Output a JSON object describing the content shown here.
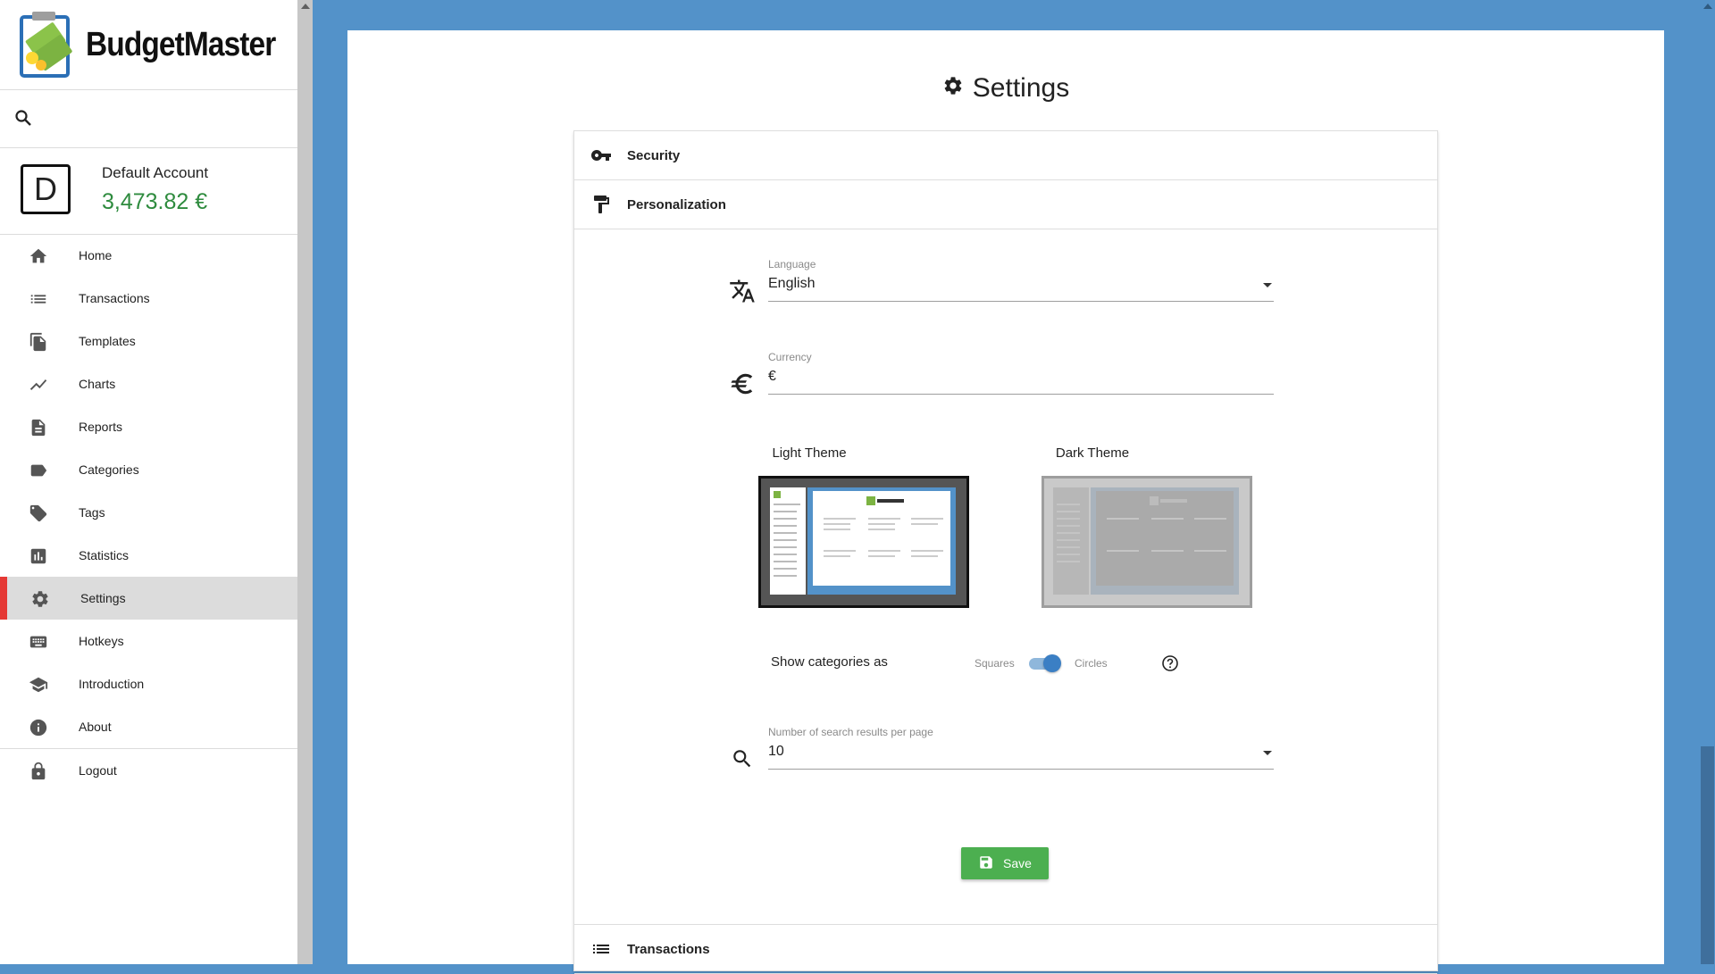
{
  "app": {
    "name": "BudgetMaster"
  },
  "account": {
    "avatar_letter": "D",
    "name": "Default Account",
    "balance": "3,473.82 €"
  },
  "nav": {
    "items": [
      {
        "label": "Home",
        "icon": "home-icon"
      },
      {
        "label": "Transactions",
        "icon": "list-icon"
      },
      {
        "label": "Templates",
        "icon": "file-copy-icon"
      },
      {
        "label": "Charts",
        "icon": "line-chart-icon"
      },
      {
        "label": "Reports",
        "icon": "description-icon"
      },
      {
        "label": "Categories",
        "icon": "label-icon"
      },
      {
        "label": "Tags",
        "icon": "tag-icon"
      },
      {
        "label": "Statistics",
        "icon": "bar-chart-icon"
      },
      {
        "label": "Settings",
        "icon": "gear-icon",
        "active": true
      },
      {
        "label": "Hotkeys",
        "icon": "keyboard-icon"
      },
      {
        "label": "Introduction",
        "icon": "school-icon"
      },
      {
        "label": "About",
        "icon": "info-icon"
      },
      {
        "label": "Logout",
        "icon": "lock-icon"
      }
    ]
  },
  "page": {
    "title": "Settings"
  },
  "sections": {
    "security": "Security",
    "personalization": "Personalization",
    "transactions": "Transactions"
  },
  "personalization": {
    "language": {
      "label": "Language",
      "value": "English"
    },
    "currency": {
      "label": "Currency",
      "value": "€"
    },
    "themes": {
      "light": "Light Theme",
      "dark": "Dark Theme"
    },
    "categories_display": {
      "label": "Show categories as",
      "off_label": "Squares",
      "on_label": "Circles",
      "enabled": true
    },
    "search_results": {
      "label": "Number of search results per page",
      "value": "10"
    },
    "save_label": "Save"
  },
  "colors": {
    "accent": "#5392c9",
    "balance": "#2e8b3e",
    "active_marker": "#e53935",
    "save": "#4caf50"
  }
}
